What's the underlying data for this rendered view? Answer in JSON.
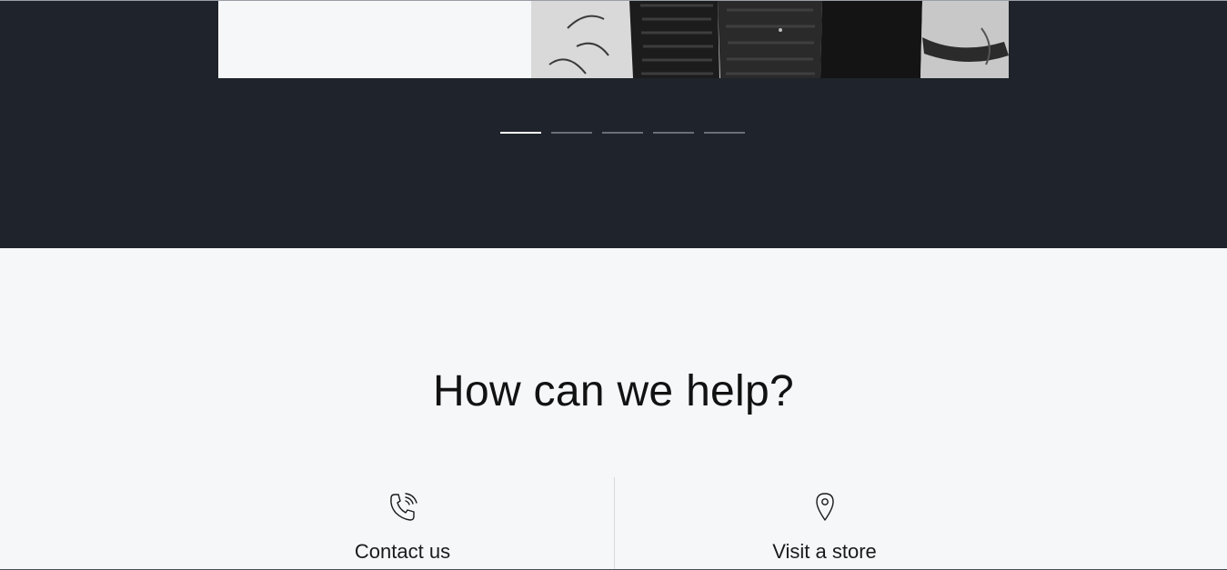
{
  "hero": {
    "carousel": {
      "slide_count": 5,
      "active_index": 0
    }
  },
  "help": {
    "title": "How can we help?",
    "contact": {
      "label": "Contact us",
      "icon": "phone-icon"
    },
    "store": {
      "label": "Visit a store",
      "icon": "map-pin-icon"
    }
  },
  "colors": {
    "hero_background": "#1f232b",
    "page_background": "#f6f7f9",
    "dot_active": "#ffffff",
    "dot_inactive": "#6b6f76",
    "text": "#121212"
  }
}
